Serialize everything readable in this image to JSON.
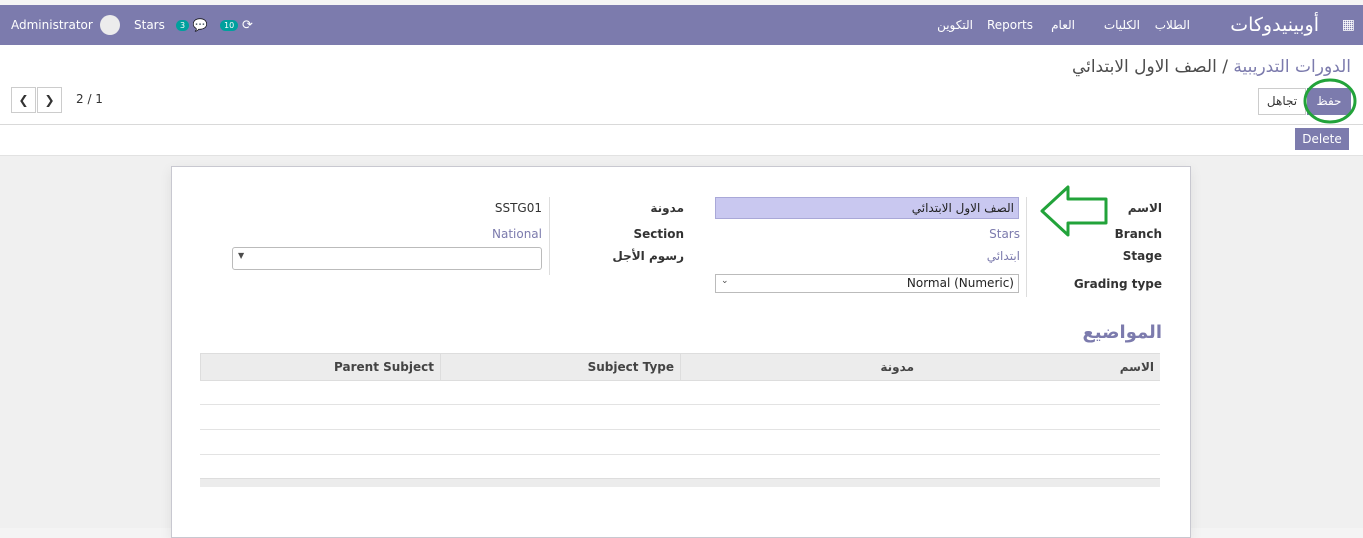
{
  "navbar": {
    "brand": "أوبينيدوكات",
    "menu": [
      "الطلاب",
      "الكليات",
      "العام",
      "Reports",
      "التكوين"
    ],
    "company": "Stars",
    "messages_count": "3",
    "activities_count": "10",
    "user": "Administrator"
  },
  "breadcrumb": {
    "parent": "الدورات التدريبية",
    "separator": "/",
    "current": "الصف الاول الابتدائي"
  },
  "buttons": {
    "save": "حفظ",
    "discard": "تجاهل",
    "delete": "Delete"
  },
  "pager": {
    "value": "2 / 1"
  },
  "form": {
    "name_label": "الاسم",
    "name_value": "الصف الاول الابتدائي",
    "branch_label": "Branch",
    "branch_value": "Stars",
    "stage_label": "Stage",
    "stage_value": "ابتدائي",
    "grading_label": "Grading type",
    "grading_value": "Normal (Numeric)",
    "code_label": "مدونة",
    "code_value": "SSTG01",
    "section_label": "Section",
    "section_value": "National",
    "fees_label": "رسوم الأجل",
    "fees_value": ""
  },
  "subjects": {
    "title": "المواضيع",
    "columns": [
      "الاسم",
      "مدونة",
      "Subject Type",
      "Parent Subject"
    ]
  },
  "colors": {
    "brand": "#7c7bad",
    "annotation": "#22a33a",
    "badge": "#00a09d"
  }
}
